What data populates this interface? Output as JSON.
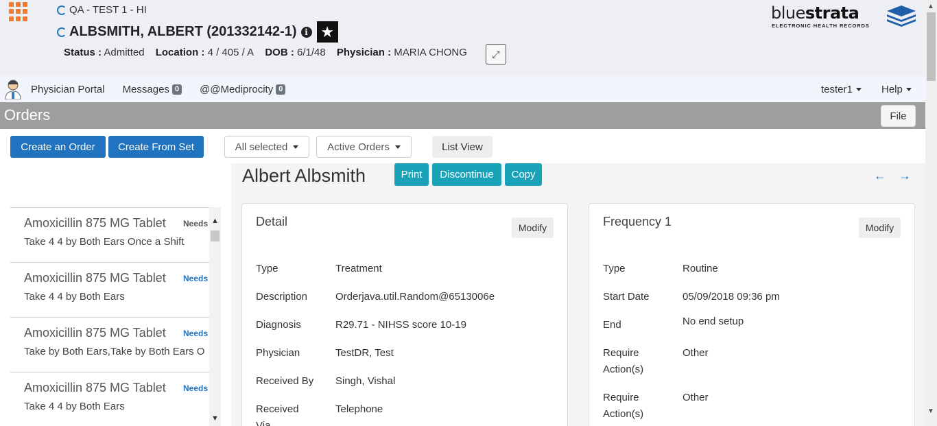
{
  "header": {
    "context": "QA - TEST 1 - HI",
    "patient_name": "ALBSMITH, ALBERT (201332142-1)",
    "status_label": "Status :",
    "status_value": "Admitted",
    "location_label": "Location :",
    "location_value": "4 / 405 / A",
    "dob_label": "DOB :",
    "dob_value": "6/1/48",
    "physician_label": "Physician :",
    "physician_value": "MARIA CHONG",
    "logo_word_light": "blue",
    "logo_word_bold": "strata",
    "logo_sub": "ELECTRONIC HEALTH RECORDS"
  },
  "nav": {
    "portal": "Physician Portal",
    "messages": "Messages",
    "messages_count": "0",
    "mediprocity": "@@Mediprocity",
    "mediprocity_count": "0",
    "user": "tester1",
    "help": "Help"
  },
  "orders_bar": {
    "title": "Orders",
    "file": "File"
  },
  "toolbar": {
    "create_order": "Create an Order",
    "create_from_set": "Create From Set",
    "filter_selected": "All selected",
    "filter_status": "Active Orders",
    "view": "List View"
  },
  "order_list": [
    {
      "name": "Amoxicillin 875 MG Tablet",
      "flag": "Needs",
      "instructions": "Take 4 4 by Both Ears Once a Shift"
    },
    {
      "name": "Amoxicillin 875 MG Tablet",
      "flag": "Needs",
      "instructions": "Take 4 4 by Both Ears"
    },
    {
      "name": "Amoxicillin 875 MG Tablet",
      "flag": "Needs",
      "instructions": "Take by Both Ears,Take by Both Ears O"
    },
    {
      "name": "Amoxicillin 875 MG Tablet",
      "flag": "Needs",
      "instructions": "Take 4 4 by Both Ears"
    }
  ],
  "detail_header": {
    "patient": "Albert Albsmith",
    "print": "Print",
    "discontinue": "Discontinue",
    "copy": "Copy"
  },
  "detail_card": {
    "title": "Detail",
    "modify": "Modify",
    "rows": [
      {
        "label": "Type",
        "value": "Treatment"
      },
      {
        "label": "Description",
        "value": "Orderjava.util.Random@6513006e"
      },
      {
        "label": "Diagnosis",
        "value": "R29.71 - NIHSS score 10-19"
      },
      {
        "label": "Physician",
        "value": "TestDR, Test"
      },
      {
        "label": "Received By",
        "value": "Singh, Vishal"
      },
      {
        "label": "Received Via",
        "value": "Telephone"
      }
    ]
  },
  "frequency_card": {
    "title": "Frequency 1",
    "modify": "Modify",
    "rows": [
      {
        "label": "Type",
        "value": "Routine"
      },
      {
        "label": "Start Date",
        "value": "05/09/2018 09:36 pm"
      },
      {
        "label": "End",
        "value": "No end setup"
      },
      {
        "label": "Require Action(s)",
        "value": "Other"
      },
      {
        "label": "Require Action(s)",
        "value": "Other"
      }
    ]
  },
  "colors": {
    "primary": "#1f73bf",
    "teal": "#19a2b8",
    "orders_bar": "#9e9e9e",
    "apps_icon": "#f47a2b"
  }
}
